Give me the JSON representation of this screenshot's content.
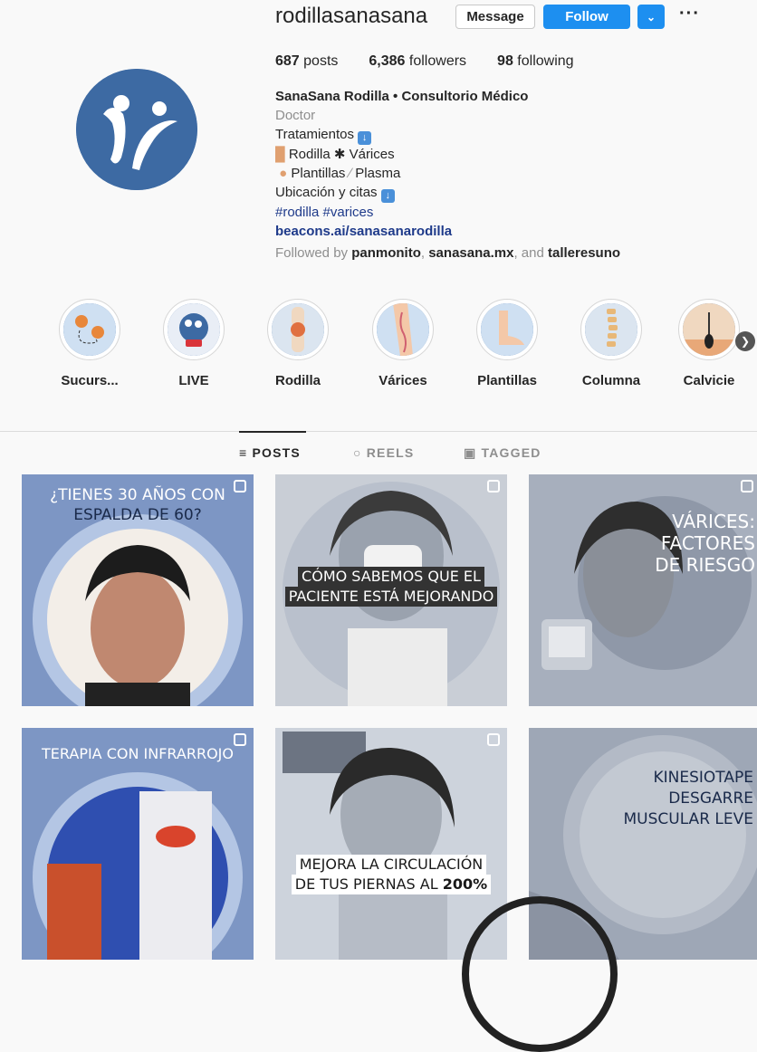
{
  "profile": {
    "username": "rodillasanasana",
    "message_label": "Message",
    "follow_label": "Follow",
    "dropdown_icon": "chevron-down-icon",
    "more_icon": "more-icon",
    "posts_count": "687",
    "posts_label": "posts",
    "followers_count": "6,386",
    "followers_label": "followers",
    "following_count": "98",
    "following_label": "following"
  },
  "bio": {
    "name": "SanaSana Rodilla • Consultorio Médico",
    "category": "Doctor",
    "line1": "Tratamientos",
    "line2a": "Rodilla",
    "line2b": "Várices",
    "line3a": "Plantillas",
    "line3b": "Plasma",
    "line4": "Ubicación y citas",
    "hashtags": "#rodilla #varices",
    "link": "beacons.ai/sanasanarodilla",
    "followed_prefix": "Followed by",
    "followed_user1": "panmonito",
    "followed_user2": "sanasana.mx",
    "followed_and": "and",
    "followed_user3": "talleresuno"
  },
  "highlights": [
    {
      "label": "Sucurs...",
      "icon": "map-pin-icon"
    },
    {
      "label": "LIVE",
      "icon": "logo-icon"
    },
    {
      "label": "Rodilla",
      "icon": "knee-icon"
    },
    {
      "label": "Várices",
      "icon": "leg-icon"
    },
    {
      "label": "Plantillas",
      "icon": "foot-icon"
    },
    {
      "label": "Columna",
      "icon": "spine-icon"
    },
    {
      "label": "Calvicie",
      "icon": "hair-icon"
    }
  ],
  "tabs": {
    "posts": "POSTS",
    "reels": "REELS",
    "tagged": "TAGGED"
  },
  "posts": [
    {
      "line1": "¿TIENES 30 AÑOS CON",
      "line2": "ESPALDA DE 60?"
    },
    {
      "line1": "CÓMO SABEMOS QUE EL",
      "line2": "PACIENTE ESTÁ MEJORANDO"
    },
    {
      "line1": "VÁRICES:",
      "line2": "FACTORES",
      "line3": "DE RIESGO"
    },
    {
      "line1": "TERAPIA CON INFRARROJO"
    },
    {
      "line1": "MEJORA LA CIRCULACIÓN",
      "line2": "DE TUS PIERNAS AL",
      "line2b": "200%"
    },
    {
      "line1": "KINESIOTAPE",
      "line2": "DESGARRE",
      "line3": "MUSCULAR LEVE"
    }
  ],
  "colors": {
    "brand_blue": "#3d6aa3",
    "follow_blue": "#1d8ff0",
    "link_navy": "#1e3a8a",
    "muted_gray": "#8e8e8e"
  }
}
